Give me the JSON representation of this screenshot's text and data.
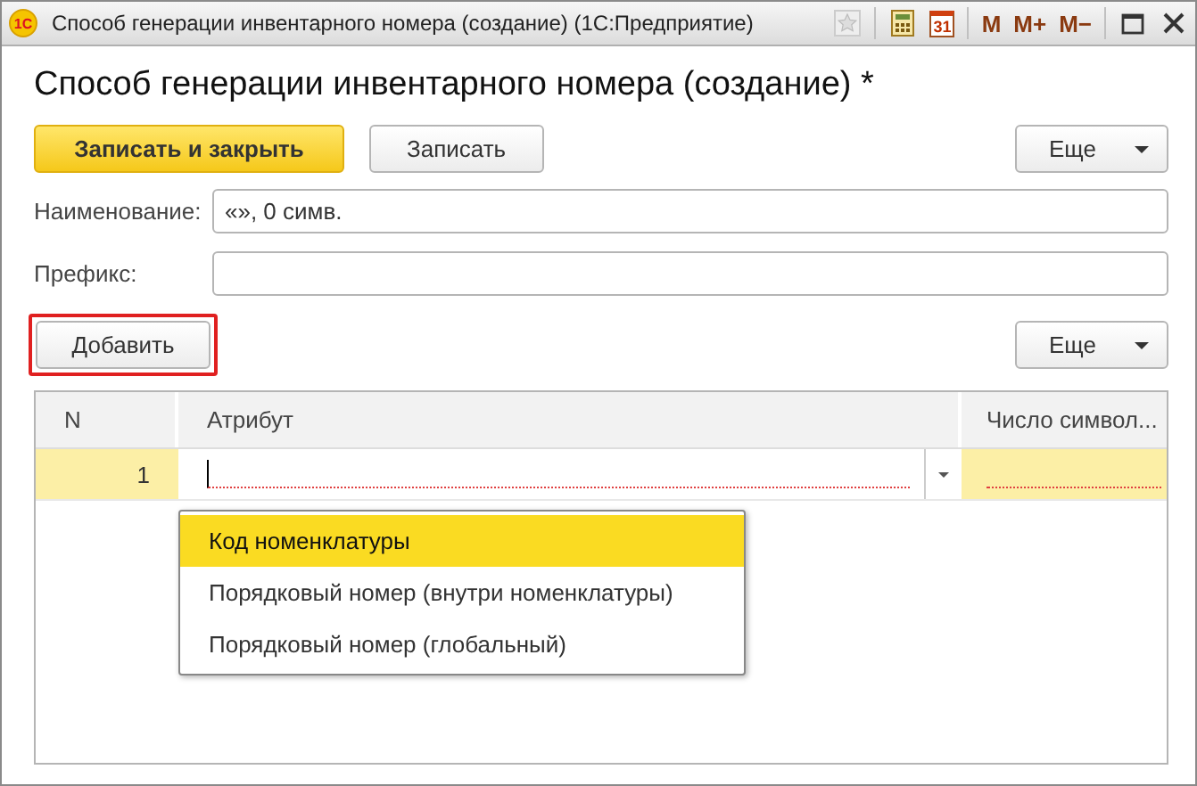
{
  "window": {
    "title": "Способ генерации инвентарного номера (создание)  (1С:Предприятие)",
    "logo": "1С",
    "calendar_day": "31",
    "memory_buttons": [
      "M",
      "M+",
      "M−"
    ]
  },
  "form": {
    "heading": "Способ генерации инвентарного номера (создание) *",
    "toolbar": [
      {
        "label": "Записать и закрыть",
        "kind": "primary"
      },
      {
        "label": "Записать",
        "kind": "normal"
      }
    ],
    "more_button": "Еще",
    "fields": [
      {
        "label": "Наименование:",
        "value": "«», 0 симв."
      },
      {
        "label": "Префикс:"
      }
    ],
    "add_button": {
      "label": "Добавить",
      "highlighted": true
    },
    "table_more_button": "Еще",
    "table": {
      "columns": [
        "N",
        "Атрибут",
        "Число символ..."
      ],
      "rows": [
        {
          "n": "1",
          "selected": true
        }
      ]
    },
    "dropdown": [
      {
        "label": "Код номенклатуры",
        "selected": true
      },
      {
        "label": "Порядковый номер (внутри номенклатуры)",
        "selected": false
      },
      {
        "label": "Порядковый номер (глобальный)",
        "selected": false
      }
    ]
  }
}
